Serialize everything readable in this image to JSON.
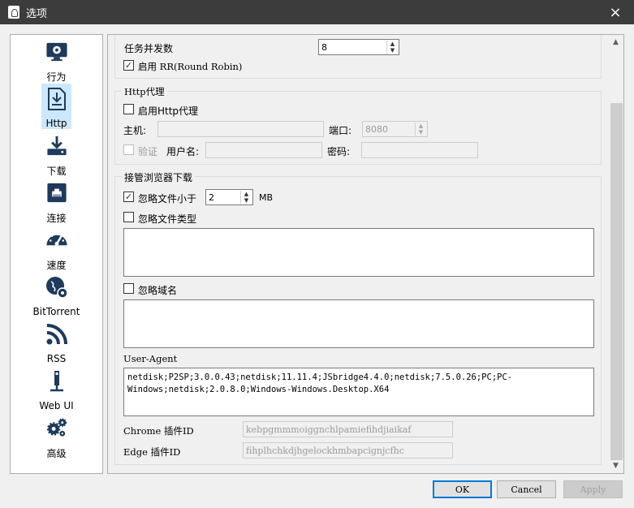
{
  "window": {
    "title": "选项",
    "close_icon": "×"
  },
  "sidebar": {
    "items": [
      {
        "label": "行为",
        "icon": "monitor-gear-icon"
      },
      {
        "label": "Http",
        "icon": "download-doc-icon",
        "selected": true
      },
      {
        "label": "下载",
        "icon": "tray-download-icon"
      },
      {
        "label": "连接",
        "icon": "network-port-icon"
      },
      {
        "label": "速度",
        "icon": "speedometer-icon"
      },
      {
        "label": "BitTorrent",
        "icon": "globe-gear-icon"
      },
      {
        "label": "RSS",
        "icon": "rss-icon"
      },
      {
        "label": "Web UI",
        "icon": "usb-plug-icon"
      },
      {
        "label": "高级",
        "icon": "gears-icon"
      }
    ]
  },
  "task": {
    "concurrent_label": "任务并发数",
    "concurrent_value": "8",
    "rr_label": "启用 RR(Round Robin)",
    "rr_checked": "✓"
  },
  "proxy": {
    "group_title": "Http代理",
    "enable_label": "启用Http代理",
    "host_label": "主机:",
    "host_value": "",
    "port_label": "端口:",
    "port_value": "8080",
    "auth_label": "验证",
    "user_label": "用户名:",
    "user_value": "",
    "pass_label": "密码:",
    "pass_value": ""
  },
  "browser": {
    "group_title": "接管浏览器下载",
    "ignore_size_label": "忽略文件小于",
    "ignore_size_checked": "✓",
    "ignore_size_value": "2",
    "ignore_size_unit": "MB",
    "ignore_type_label": "忽略文件类型",
    "ignore_type_value": "",
    "ignore_domain_label": "忽略域名",
    "ignore_domain_value": "",
    "ua_label": "User-Agent",
    "ua_value": "netdisk;P2SP;3.0.0.43;netdisk;11.11.4;JSbridge4.4.0;netdisk;7.5.0.26;PC;PC-Windows;netdisk;2.0.8.0;Windows-Windows.Desktop.X64",
    "chrome_label": "Chrome 插件ID",
    "chrome_value": "kebpgmmmoiggnchlpamiefihdjiaikaf",
    "edge_label": "Edge 插件ID",
    "edge_value": "fihplhchkdjhgelockhmbapcignjcfhc"
  },
  "buttons": {
    "ok": "OK",
    "cancel": "Cancel",
    "apply": "Apply"
  }
}
